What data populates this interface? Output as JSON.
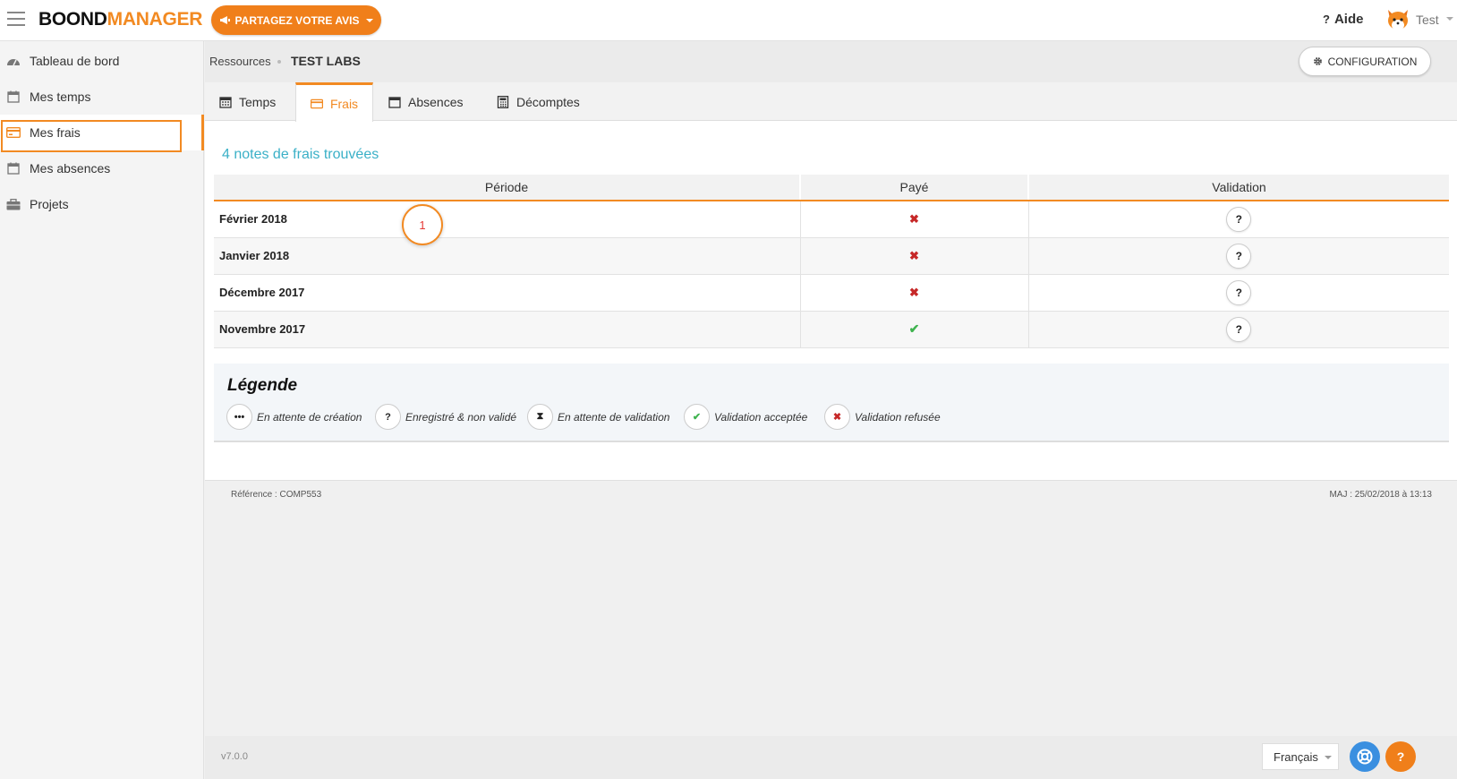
{
  "header": {
    "logo_part1": "BOOND",
    "logo_part2": "MANAGER",
    "feedback_label": "PARTAGEZ VOTRE AVIS",
    "help_label": "Aide",
    "user_name": "Test"
  },
  "sidebar": {
    "items": [
      {
        "label": "Tableau de bord",
        "icon": "dashboard-icon"
      },
      {
        "label": "Mes temps",
        "icon": "calendar-icon"
      },
      {
        "label": "Mes frais",
        "icon": "credit-card-icon"
      },
      {
        "label": "Mes absences",
        "icon": "calendar-icon"
      },
      {
        "label": "Projets",
        "icon": "briefcase-icon"
      }
    ],
    "active_index": 2
  },
  "breadcrumb": {
    "parent": "Ressources",
    "current": "TEST LABS"
  },
  "config_button": "CONFIGURATION",
  "tabs": [
    {
      "label": "Temps",
      "icon": "calendar-icon"
    },
    {
      "label": "Frais",
      "icon": "credit-card-icon"
    },
    {
      "label": "Absences",
      "icon": "calendar-icon"
    },
    {
      "label": "Décomptes",
      "icon": "calculator-icon"
    }
  ],
  "active_tab": "Frais",
  "results_title": "4 notes de frais trouvées",
  "table": {
    "headers": {
      "period": "Période",
      "paid": "Payé",
      "validation": "Validation"
    },
    "rows": [
      {
        "period": "Février 2018",
        "paid": false,
        "validation": "?"
      },
      {
        "period": "Janvier 2018",
        "paid": false,
        "validation": "?"
      },
      {
        "period": "Décembre 2017",
        "paid": false,
        "validation": "?"
      },
      {
        "period": "Novembre 2017",
        "paid": true,
        "validation": "?"
      }
    ]
  },
  "annotation": "1",
  "legend": {
    "title": "Légende",
    "items": [
      {
        "symbol": "•••",
        "label": "En attente de création"
      },
      {
        "symbol": "?",
        "label": "Enregistré & non validé"
      },
      {
        "symbol": "⧗",
        "label": "En attente de validation"
      },
      {
        "symbol": "✔",
        "label": "Validation acceptée"
      },
      {
        "symbol": "✖",
        "label": "Validation refusée"
      }
    ]
  },
  "footer": {
    "reference": "Référence : COMP553",
    "updated": "MAJ : 25/02/2018 à 13:13",
    "version": "v7.0.0",
    "language": "Français"
  },
  "colors": {
    "accent": "#f28a22",
    "link": "#3ab0c7",
    "refused": "#c62828",
    "accepted": "#3fb34f"
  }
}
